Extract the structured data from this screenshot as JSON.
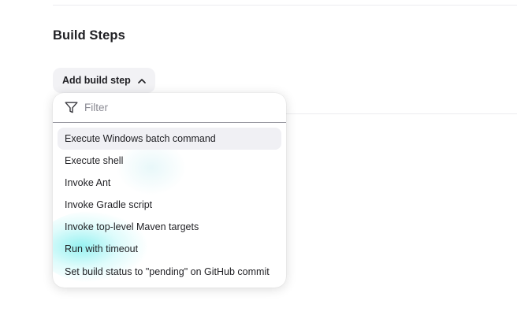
{
  "section": {
    "title": "Build Steps"
  },
  "add_step_button": {
    "label": "Add build step",
    "icon": "chevron-up-icon",
    "expanded": true
  },
  "dropdown": {
    "filter": {
      "icon": "filter-icon",
      "placeholder": "Filter",
      "value": ""
    },
    "items": [
      {
        "label": "Execute Windows batch command",
        "active": true
      },
      {
        "label": "Execute shell",
        "active": false
      },
      {
        "label": "Invoke Ant",
        "active": false
      },
      {
        "label": "Invoke Gradle script",
        "active": false
      },
      {
        "label": "Invoke top-level Maven targets",
        "active": false
      },
      {
        "label": "Run with timeout",
        "active": false
      },
      {
        "label": "Set build status to \"pending\" on GitHub commit",
        "active": false
      }
    ]
  },
  "colors": {
    "highlight_bg": "#f0f0f4",
    "button_bg": "#f2f2f5",
    "text": "#1f1f23",
    "placeholder": "#8a8a93"
  }
}
